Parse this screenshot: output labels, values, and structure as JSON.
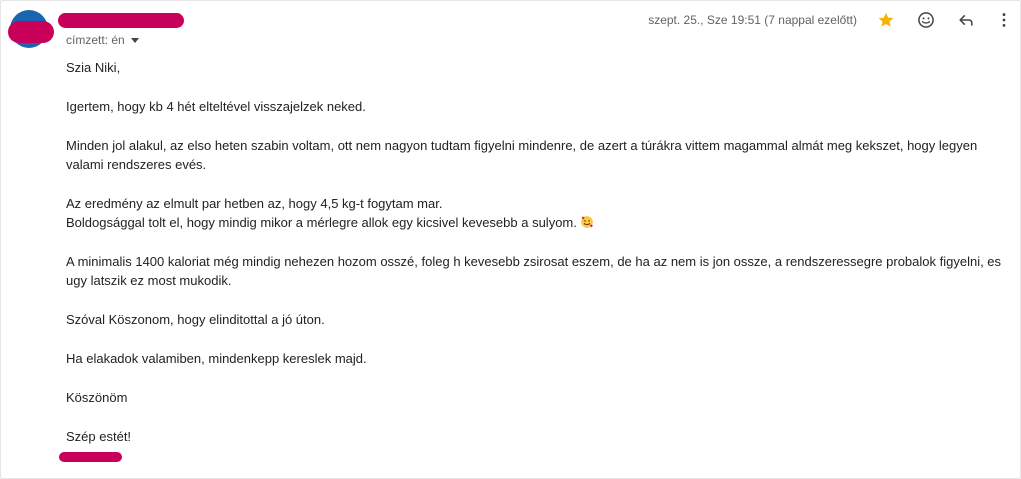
{
  "header": {
    "recipient_label": "címzett: én",
    "timestamp": "szept. 25., Sze 19:51 (7 nappal ezelőtt)"
  },
  "colors": {
    "star": "#f4b400",
    "avatar": "#1a65b0",
    "redaction": "#c8005a"
  },
  "icons": [
    "star-icon",
    "emoji-icon",
    "reply-icon",
    "more-vert-icon",
    "chevron-down-icon",
    "smiling-face-with-hearts-emoji"
  ],
  "body": {
    "greeting": "Szia Niki,",
    "p1": "Igertem, hogy kb 4 hét elteltével visszajelzek neked.",
    "p2": "Minden jol alakul, az elso heten szabin voltam, ott nem nagyon tudtam figyelni mindenre, de azert a túrákra vittem magammal almát meg kekszet, hogy legyen valami rendszeres evés.",
    "p3_line1": "Az eredmény az elmult par hetben az, hogy 4,5 kg-t fogytam mar.",
    "p3_line2": "Boldogsággal tolt el, hogy mindig mikor a mérlegre allok egy kicsivel kevesebb a sulyom.",
    "p4": "A minimalis 1400 kaloriat még mindig nehezen hozom osszé, foleg h kevesebb zsirosat eszem, de ha az nem is jon ossze, a rendszeressegre probalok figyelni, es ugy latszik ez most mukodik.",
    "p5": "Szóval Köszonom, hogy elinditottal a jó úton.",
    "p6": "Ha elakadok valamiben, mindenkepp kereslek majd.",
    "p7": "Köszönöm",
    "p8": "Szép estét!"
  }
}
